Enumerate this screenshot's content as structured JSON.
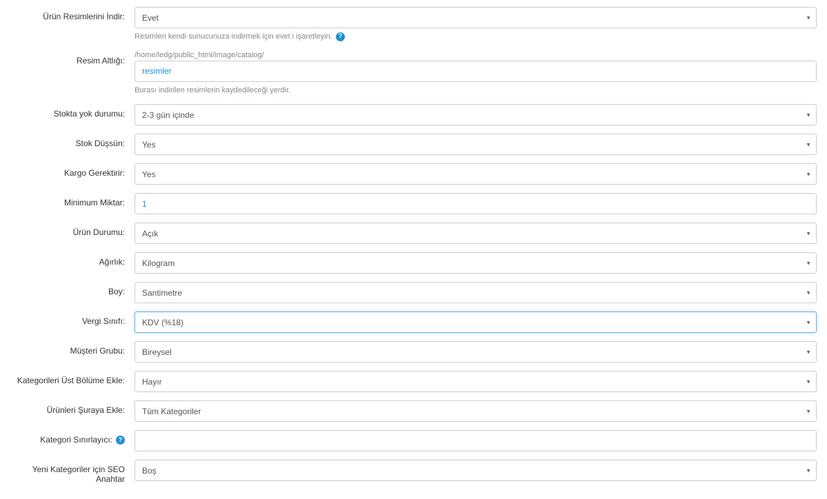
{
  "fields": {
    "download_images": {
      "label": "Ürün Resimlerini İndir:",
      "value": "Evet",
      "help": "Resimleri kendi sunucunuza indirmek için evet i işaretleyin."
    },
    "image_subpath": {
      "label": "Resim Altlığı:",
      "path": "/home/ledg/public_html/image/catalog/",
      "value": "resimler",
      "help": "Burası indirilen resimlerin kaydedileceği yerdir."
    },
    "out_of_stock": {
      "label": "Stokta yok durumu:",
      "value": "2-3 gün içinde"
    },
    "subtract_stock": {
      "label": "Stok Düşsün:",
      "value": "Yes"
    },
    "requires_shipping": {
      "label": "Kargo Gerektirir:",
      "value": "Yes"
    },
    "minimum_qty": {
      "label": "Minimum Miktar:",
      "value": "1"
    },
    "product_status": {
      "label": "Ürün Durumu:",
      "value": "Açık"
    },
    "weight": {
      "label": "Ağırlık:",
      "value": "Kilogram"
    },
    "length": {
      "label": "Boy:",
      "value": "Santimetre"
    },
    "tax_class": {
      "label": "Vergi Sınıfı:",
      "value": "KDV (%18)"
    },
    "customer_group": {
      "label": "Müşteri Grubu:",
      "value": "Bireysel"
    },
    "add_categories_top": {
      "label": "Kategorileri Üst Bölüme Ekle:",
      "value": "Hayır"
    },
    "add_products_to": {
      "label": "Ürünleri Şuraya Ekle:",
      "value": "Tüm Kategoriler"
    },
    "category_delimiter": {
      "label": "Kategori Sınırlayıcı:",
      "value": ""
    },
    "seo_key_new_categories": {
      "label": "Yeni Kategoriler için SEO Anahtar",
      "value": "Boş"
    }
  }
}
